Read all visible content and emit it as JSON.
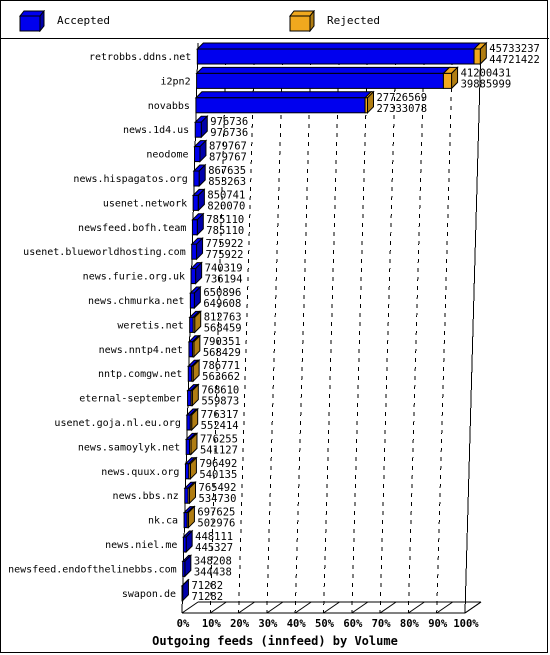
{
  "legend": {
    "items": [
      {
        "label": "Accepted",
        "color": "#0000ee",
        "icon": "cube-icon"
      },
      {
        "label": "Rejected",
        "color": "#f0a81e",
        "icon": "cube-icon"
      }
    ]
  },
  "axis": {
    "title": "Outgoing feeds (innfeed) by Volume",
    "ticks": [
      "0%",
      "10%",
      "20%",
      "30%",
      "40%",
      "50%",
      "60%",
      "70%",
      "80%",
      "90%",
      "100%"
    ]
  },
  "chart_data": {
    "type": "bar",
    "orientation": "horizontal",
    "title": "Outgoing feeds (innfeed) by Volume",
    "xlabel": "Outgoing feeds (innfeed) by Volume",
    "ylabel": "",
    "xlim": [
      0,
      100
    ],
    "xunit": "percent",
    "xtick_labels": [
      "0%",
      "10%",
      "20%",
      "30%",
      "40%",
      "50%",
      "60%",
      "70%",
      "80%",
      "90%",
      "100%"
    ],
    "grid": true,
    "grid_style": "dashed-vertical",
    "legend_position": "top",
    "style": "3d-horizontal-stacked",
    "series": [
      {
        "name": "Accepted",
        "color": "#0000ee"
      },
      {
        "name": "Rejected",
        "color": "#f0a81e"
      }
    ],
    "categories": [
      "retrobbs.ddns.net",
      "i2pn2",
      "novabbs",
      "news.1d4.us",
      "neodome",
      "news.hispagatos.org",
      "usenet.network",
      "newsfeed.bofh.team",
      "usenet.blueworldhosting.com",
      "news.furie.org.uk",
      "news.chmurka.net",
      "weretis.net",
      "news.nntp4.net",
      "nntp.comgw.net",
      "eternal-september",
      "usenet.goja.nl.eu.org",
      "news.samoylyk.net",
      "news.quux.org",
      "news.bbs.nz",
      "nk.ca",
      "news.niel.me",
      "newsfeed.endofthelinebbs.com",
      "swapon.de"
    ],
    "rows": [
      {
        "category": "retrobbs.ddns.net",
        "total": 45733237,
        "accepted": 44721422,
        "label_top": "45733237",
        "label_bottom": "44721422",
        "total_pct": 100.0,
        "accepted_pct": 97.79
      },
      {
        "category": "i2pn2",
        "total": 41200431,
        "accepted": 39885999,
        "label_top": "41200431",
        "label_bottom": "39885999",
        "total_pct": 90.09,
        "accepted_pct": 96.81
      },
      {
        "category": "novabbs",
        "total": 27726569,
        "accepted": 27333078,
        "label_top": "27726569",
        "label_bottom": "27333078",
        "total_pct": 60.63,
        "accepted_pct": 98.58
      },
      {
        "category": "news.1d4.us",
        "total": 976736,
        "accepted": 976736,
        "label_top": "976736",
        "label_bottom": "976736",
        "total_pct": 2.14,
        "accepted_pct": 100.0
      },
      {
        "category": "neodome",
        "total": 879767,
        "accepted": 879767,
        "label_top": "879767",
        "label_bottom": "879767",
        "total_pct": 1.92,
        "accepted_pct": 100.0
      },
      {
        "category": "news.hispagatos.org",
        "total": 867635,
        "accepted": 853263,
        "label_top": "867635",
        "label_bottom": "853263",
        "total_pct": 1.9,
        "accepted_pct": 98.34
      },
      {
        "category": "usenet.network",
        "total": 850741,
        "accepted": 820070,
        "label_top": "850741",
        "label_bottom": "820070",
        "total_pct": 1.86,
        "accepted_pct": 96.39
      },
      {
        "category": "newsfeed.bofh.team",
        "total": 785110,
        "accepted": 785110,
        "label_top": "785110",
        "label_bottom": "785110",
        "total_pct": 1.72,
        "accepted_pct": 100.0
      },
      {
        "category": "usenet.blueworldhosting.com",
        "total": 775922,
        "accepted": 775922,
        "label_top": "775922",
        "label_bottom": "775922",
        "total_pct": 1.7,
        "accepted_pct": 100.0
      },
      {
        "category": "news.furie.org.uk",
        "total": 740319,
        "accepted": 736194,
        "label_top": "740319",
        "label_bottom": "736194",
        "total_pct": 1.62,
        "accepted_pct": 99.44
      },
      {
        "category": "news.chmurka.net",
        "total": 650896,
        "accepted": 649608,
        "label_top": "650896",
        "label_bottom": "649608",
        "total_pct": 1.42,
        "accepted_pct": 99.8
      },
      {
        "category": "weretis.net",
        "total": 812763,
        "accepted": 568459,
        "label_top": "812763",
        "label_bottom": "568459",
        "total_pct": 1.78,
        "accepted_pct": 69.94
      },
      {
        "category": "news.nntp4.net",
        "total": 790351,
        "accepted": 568429,
        "label_top": "790351",
        "label_bottom": "568429",
        "total_pct": 1.73,
        "accepted_pct": 71.92
      },
      {
        "category": "nntp.comgw.net",
        "total": 786771,
        "accepted": 563662,
        "label_top": "786771",
        "label_bottom": "563662",
        "total_pct": 1.72,
        "accepted_pct": 71.64
      },
      {
        "category": "eternal-september",
        "total": 768610,
        "accepted": 559873,
        "label_top": "768610",
        "label_bottom": "559873",
        "total_pct": 1.68,
        "accepted_pct": 72.84
      },
      {
        "category": "usenet.goja.nl.eu.org",
        "total": 776317,
        "accepted": 552414,
        "label_top": "776317",
        "label_bottom": "552414",
        "total_pct": 1.7,
        "accepted_pct": 71.16
      },
      {
        "category": "news.samoylyk.net",
        "total": 776255,
        "accepted": 541127,
        "label_top": "776255",
        "label_bottom": "541127",
        "total_pct": 1.7,
        "accepted_pct": 69.71
      },
      {
        "category": "news.quux.org",
        "total": 796492,
        "accepted": 540135,
        "label_top": "796492",
        "label_bottom": "540135",
        "total_pct": 1.74,
        "accepted_pct": 67.81
      },
      {
        "category": "news.bbs.nz",
        "total": 765492,
        "accepted": 534730,
        "label_top": "765492",
        "label_bottom": "534730",
        "total_pct": 1.67,
        "accepted_pct": 69.85
      },
      {
        "category": "nk.ca",
        "total": 697625,
        "accepted": 502976,
        "label_top": "697625",
        "label_bottom": "502976",
        "total_pct": 1.53,
        "accepted_pct": 72.1
      },
      {
        "category": "news.niel.me",
        "total": 448111,
        "accepted": 445327,
        "label_top": "448111",
        "label_bottom": "445327",
        "total_pct": 0.98,
        "accepted_pct": 99.38
      },
      {
        "category": "newsfeed.endofthelinebbs.com",
        "total": 348208,
        "accepted": 344438,
        "label_top": "348208",
        "label_bottom": "344438",
        "total_pct": 0.76,
        "accepted_pct": 98.92
      },
      {
        "category": "swapon.de",
        "total": 71282,
        "accepted": 71282,
        "label_top": "71282",
        "label_bottom": "71282",
        "total_pct": 0.16,
        "accepted_pct": 100.0
      }
    ]
  }
}
